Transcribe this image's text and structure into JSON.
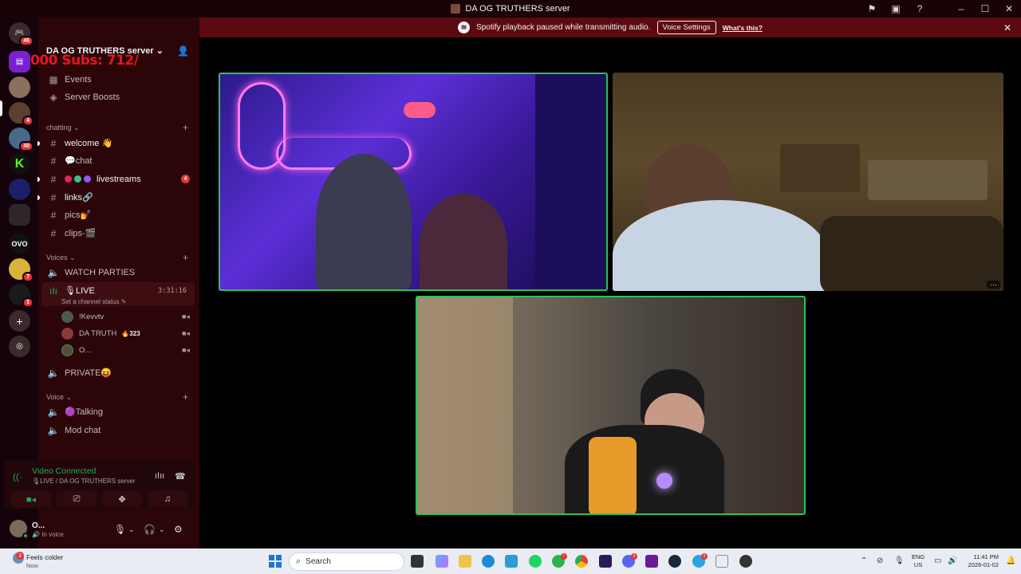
{
  "window": {
    "title": "DA OG TRUTHERS server",
    "controls": [
      "flag-icon",
      "inbox-icon",
      "help-icon",
      "minimize-icon",
      "maximize-icon",
      "close-icon"
    ]
  },
  "notice": {
    "message": "Spotify playback paused while transmitting audio.",
    "button_label": "Voice Settings",
    "link_label": "What's this?"
  },
  "rail": {
    "home_badge": "46",
    "servers": [
      {
        "badge": ""
      },
      {
        "badge": "4"
      },
      {
        "badge": "40"
      },
      {
        "badge": ""
      },
      {
        "badge": ""
      },
      {
        "badge": ""
      },
      {
        "badge": ""
      },
      {
        "badge": "7"
      },
      {
        "badge": "1"
      }
    ],
    "add_label": "+",
    "discover_label": "discover"
  },
  "server": {
    "name": "DA OG TRUTHERS server ⌄",
    "overlay_text": "000  Subs: 712/"
  },
  "sidebar": {
    "top_items": [
      {
        "label": "Events"
      },
      {
        "label": "Server Boosts"
      }
    ],
    "categories": {
      "chatting": "chatting ⌄",
      "voices": "Voices ⌄",
      "voice": "Voice ⌄"
    },
    "text_channels": [
      {
        "label": "welcome 👋"
      },
      {
        "label": "💬chat"
      },
      {
        "label": "livestreams",
        "badge": "4"
      },
      {
        "label": "links🔗"
      },
      {
        "label": "pics💅"
      },
      {
        "label": "clips-🎬"
      }
    ],
    "voice_channels": [
      {
        "label": "WATCH PARTIES"
      },
      {
        "label": "🎙LIVE",
        "timer": "3:31:16",
        "status": "Set a channel status"
      },
      {
        "label": "PRIVATE😝"
      }
    ],
    "members": [
      {
        "name": "!Kevvtv"
      },
      {
        "name": "DA TRUTH",
        "level": "🔥323"
      },
      {
        "name": "O..."
      }
    ],
    "voice_cat_channels": [
      {
        "label": "🟣Talking"
      },
      {
        "label": "Mod chat"
      }
    ]
  },
  "voice_panel": {
    "title": "Video Connected",
    "subtitle": "🎙LIVE / DA OG TRUTHERS server"
  },
  "user": {
    "name": "O...",
    "status": "In voice"
  },
  "tiles": {
    "more_label": "···"
  },
  "taskbar": {
    "weather_badge": "3",
    "weather_title": "Feels colder",
    "weather_sub": "Now",
    "search_placeholder": "Search",
    "lang_top": "ENG",
    "lang_bottom": "US",
    "time": "11:41 PM",
    "date": "2026-01-02",
    "app_badges": [
      "!",
      "3",
      "3"
    ]
  },
  "colors": {
    "sidebar_bg": "#2b0508",
    "notice_bg": "#5a0a10",
    "speaking_border": "#2fbf5f",
    "overlay_red": "#e8131f"
  }
}
